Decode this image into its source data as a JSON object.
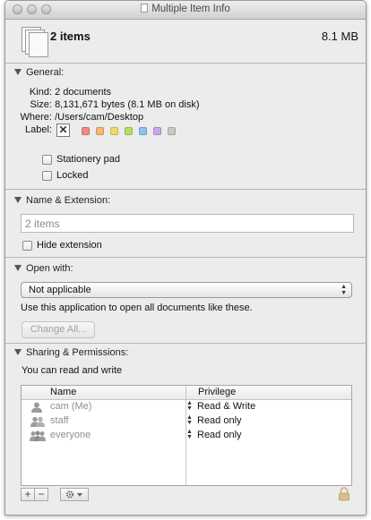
{
  "window": {
    "title": "Multiple Item Info"
  },
  "header": {
    "title": "2 items",
    "size": "8.1 MB"
  },
  "general": {
    "heading": "General:",
    "kind_label": "Kind:",
    "kind_value": "2 documents",
    "size_label": "Size:",
    "size_value": "8,131,671 bytes (8.1 MB on disk)",
    "where_label": "Where:",
    "where_value": "/Users/cam/Desktop",
    "label_label": "Label:",
    "label_none_glyph": "✕",
    "label_colors": [
      "#f08a84",
      "#f5b870",
      "#eedc6a",
      "#b7dd70",
      "#8cc3f2",
      "#c9a6ea",
      "#c7c7c7"
    ],
    "stationery_label": "Stationery pad",
    "stationery_checked": false,
    "locked_label": "Locked",
    "locked_checked": false
  },
  "name_extension": {
    "heading": "Name & Extension:",
    "name_placeholder": "2 items",
    "hide_extension_label": "Hide extension",
    "hide_extension_checked": false
  },
  "open_with": {
    "heading": "Open with:",
    "selected": "Not applicable",
    "note": "Use this application to open all documents like these.",
    "change_all_label": "Change All..."
  },
  "sharing": {
    "heading": "Sharing & Permissions:",
    "status": "You can read and write",
    "columns": {
      "name": "Name",
      "privilege": "Privilege"
    },
    "rows": [
      {
        "name": "cam (Me)",
        "privilege": "Read & Write",
        "icon": "user-icon"
      },
      {
        "name": "staff",
        "privilege": "Read only",
        "icon": "group-icon"
      },
      {
        "name": "everyone",
        "privilege": "Read only",
        "icon": "everyone-icon"
      }
    ],
    "add_glyph": "+",
    "remove_glyph": "−",
    "action_icon": "gear-icon",
    "lock_icon": "lock-icon"
  }
}
